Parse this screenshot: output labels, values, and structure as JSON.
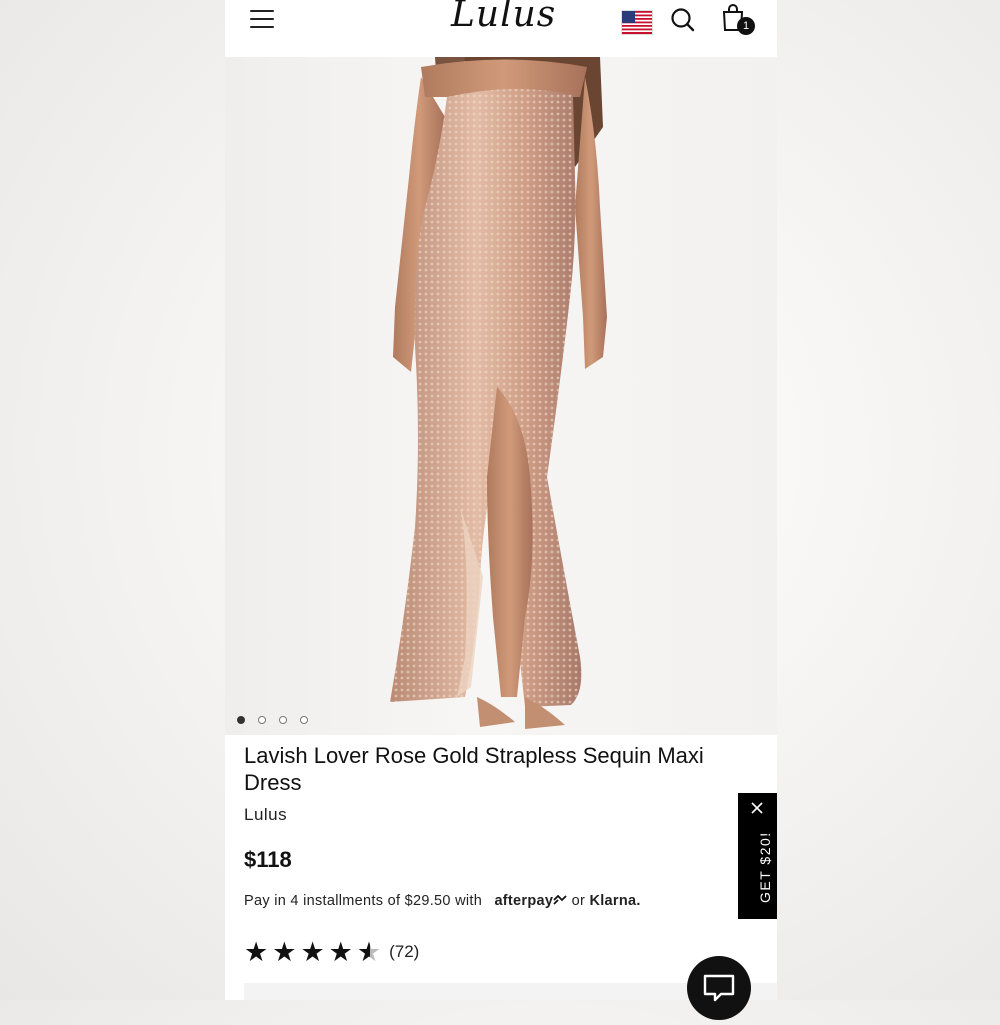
{
  "header": {
    "logo_text": "Lulus",
    "menu_icon": "hamburger-menu-icon",
    "flag_icon": "us-flag-icon",
    "search_icon": "search-icon",
    "bag_icon": "shopping-bag-icon",
    "bag_count": "1"
  },
  "gallery": {
    "image_count": 4,
    "active_index": 0
  },
  "product": {
    "title": "Lavish Lover Rose Gold Strapless Sequin Maxi Dress",
    "brand": "Lulus",
    "price": "$118",
    "installments_text": "Pay in 4 installments of $29.50 with",
    "afterpay_label": "afterpay",
    "or_text": "or",
    "klarna_label": "Klarna.",
    "rating_stars": 4.5,
    "review_count": "(72)"
  },
  "promo": {
    "label": "GET $20!",
    "close_icon": "close-icon"
  },
  "chat": {
    "icon": "chat-bubble-icon"
  },
  "colors": {
    "accent": "#111111",
    "dress": "#d9a58e",
    "background": "#f5f3f1"
  }
}
